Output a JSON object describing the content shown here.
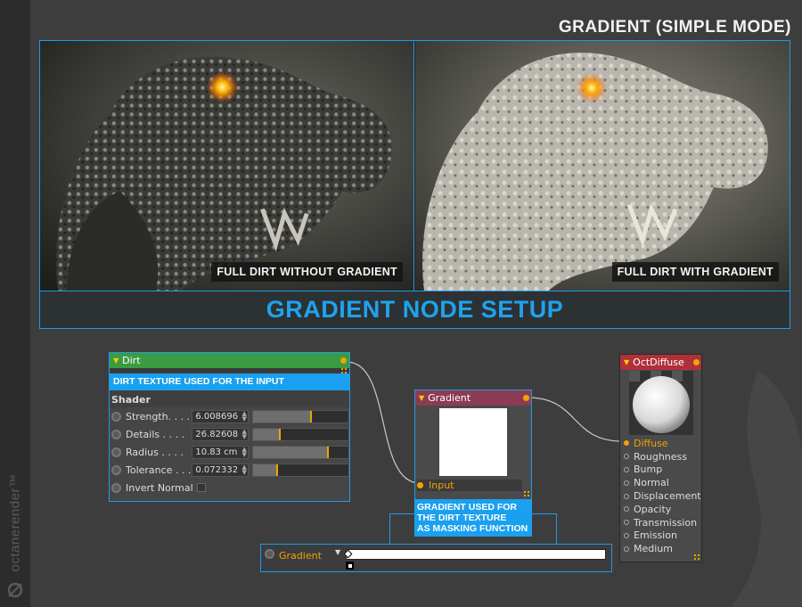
{
  "header": {
    "title": "GRADIENT (SIMPLE MODE)"
  },
  "renders": {
    "left_caption": "FULL DIRT WITHOUT GRADIENT",
    "right_caption": "FULL DIRT WITH GRADIENT"
  },
  "setup": {
    "title": "GRADIENT NODE SETUP"
  },
  "branding": {
    "text": "octanerender™"
  },
  "dirt_node": {
    "title": "Dirt",
    "note": "DIRT TEXTURE USED FOR THE INPUT",
    "section": "Shader",
    "params": [
      {
        "label": "Strength. . . .",
        "value": "6.008696",
        "slider": 0.6
      },
      {
        "label": "Details . . . .",
        "value": "26.82608",
        "slider": 0.27
      },
      {
        "label": "Radius . . . .",
        "value": "10.83 cm",
        "slider": 0.78
      },
      {
        "label": "Tolerance . . .",
        "value": "0.072332",
        "slider": 0.24
      }
    ],
    "invert_label": "Invert Normal"
  },
  "gradient_node": {
    "title": "Gradient",
    "input_label": "Input",
    "note_lines": [
      "GRADIENT USED FOR",
      "THE DIRT TEXTURE",
      "AS MASKING FUNCTION"
    ]
  },
  "diffuse_node": {
    "title": "OctDiffuse",
    "channels": [
      "Diffuse",
      "Roughness",
      "Bump",
      "Normal",
      "Displacement",
      "Opacity",
      "Transmission",
      "Emission",
      "Medium"
    ],
    "active_channel": "Diffuse"
  },
  "gradient_bar": {
    "label": "Gradient"
  },
  "colors": {
    "accent": "#1e9be6",
    "dirt_header": "#3b9b42",
    "gradient_header": "#8c3c52",
    "diffuse_header": "#b0303a",
    "port": "#f0a400"
  }
}
